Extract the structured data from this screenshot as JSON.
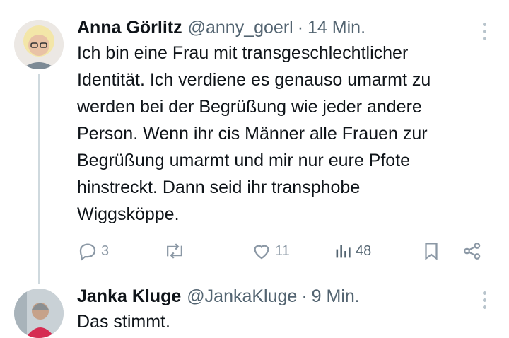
{
  "tweets": [
    {
      "name": "Anna Görlitz",
      "handle": "@anny_goerl",
      "separator": "·",
      "time": "14 Min.",
      "text_lines": [
        "Ich bin eine Frau mit transgeschlechtlicher",
        "Identität. Ich verdiene es genauso umarmt zu",
        "werden bei der Begrüßung wie jeder andere",
        "Person. Wenn ihr cis Männer alle Frauen zur",
        "Begrüßung umarmt und mir nur eure Pfote",
        "hinstreckt. Dann seid ihr  transphobe",
        "Wiggsköppe."
      ],
      "stats": {
        "replies": "3",
        "reposts": "",
        "likes": "11",
        "views": "48"
      }
    },
    {
      "name": "Janka Kluge",
      "handle": "@JankaKluge",
      "separator": "·",
      "time": "9 Min.",
      "text_lines": [
        "Das stimmt."
      ]
    }
  ],
  "colors": {
    "text": "#0f1419",
    "muted": "#536471",
    "icon": "#8b98a5",
    "thread_line": "#cfd9de"
  },
  "icons": [
    "reply-icon",
    "repost-icon",
    "like-icon",
    "views-icon",
    "bookmark-icon",
    "share-icon",
    "more-icon"
  ]
}
